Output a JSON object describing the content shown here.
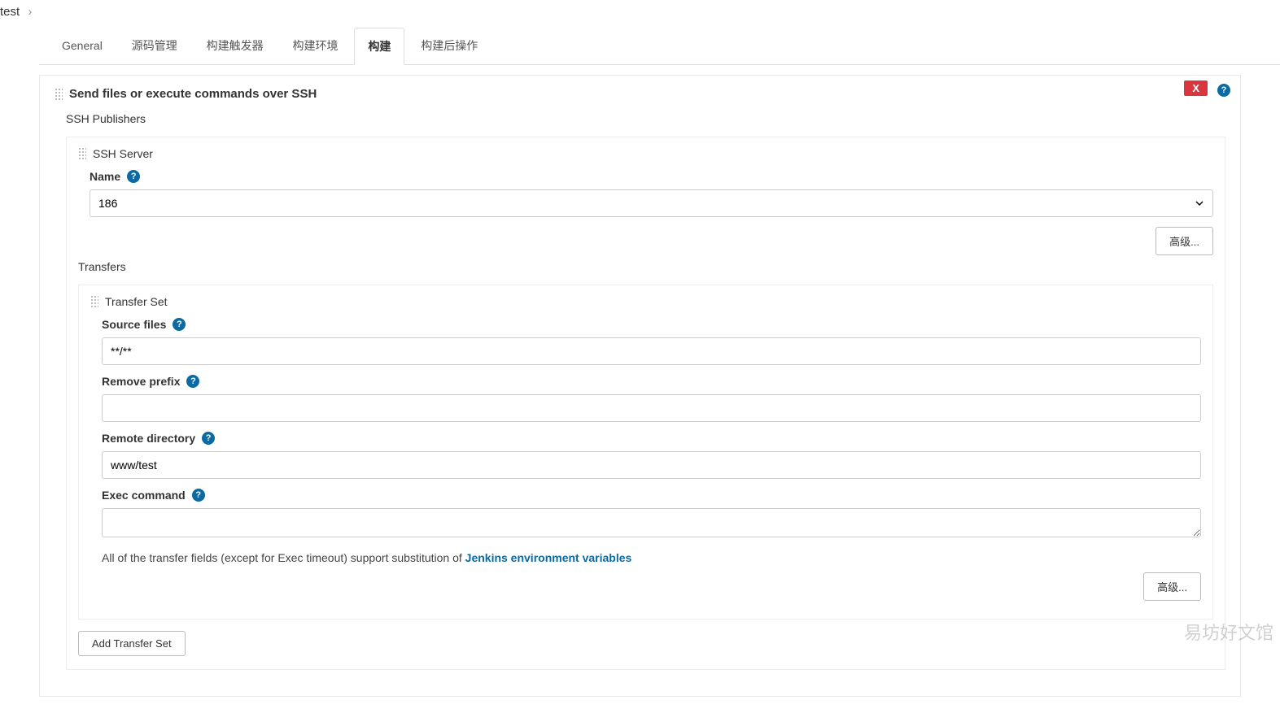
{
  "breadcrumb": {
    "item": "test"
  },
  "tabs": [
    {
      "label": "General",
      "active": false
    },
    {
      "label": "源码管理",
      "active": false
    },
    {
      "label": "构建触发器",
      "active": false
    },
    {
      "label": "构建环境",
      "active": false
    },
    {
      "label": "构建",
      "active": true
    },
    {
      "label": "构建后操作",
      "active": false
    }
  ],
  "section": {
    "title": "Send files or execute commands over SSH",
    "delete": "X",
    "publishers_label": "SSH Publishers",
    "ssh_server": {
      "title": "SSH Server",
      "name_label": "Name",
      "name_value": "186",
      "advanced_btn": "高级..."
    },
    "transfers_label": "Transfers",
    "transfer_set": {
      "title": "Transfer Set",
      "source_files_label": "Source files",
      "source_files_value": "**/**",
      "remove_prefix_label": "Remove prefix",
      "remove_prefix_value": "",
      "remote_dir_label": "Remote directory",
      "remote_dir_value": "www/test",
      "exec_label": "Exec command",
      "exec_value": "",
      "hint_prefix": "All of the transfer fields (except for Exec timeout) support substitution of ",
      "hint_link": "Jenkins environment variables",
      "advanced_btn": "高级...",
      "add_btn": "Add Transfer Set"
    }
  },
  "watermark": "易坊好文馆"
}
